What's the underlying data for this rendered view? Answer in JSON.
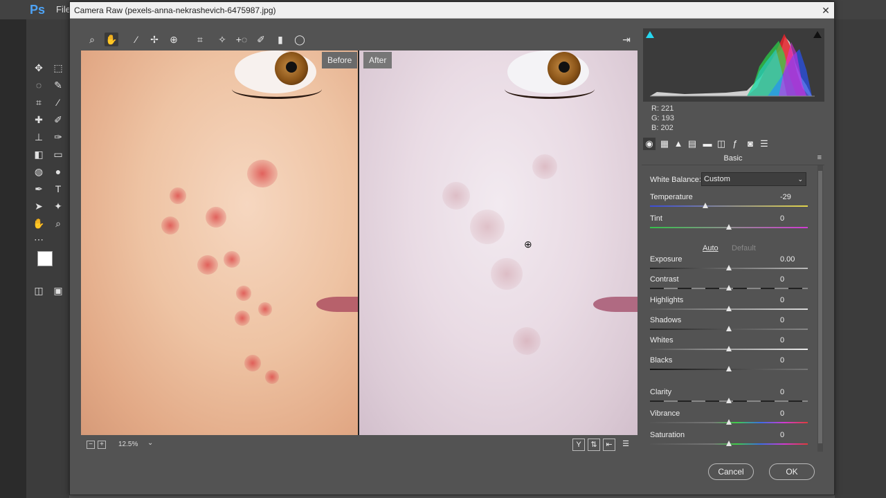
{
  "app": {
    "ps_logo": "Ps",
    "ps_menu": "File",
    "dialog_title": "Camera Raw (pexels-anna-nekrashevich-6475987.jpg)",
    "close_glyph": "✕"
  },
  "view": {
    "before_label": "Before",
    "after_label": "After",
    "zoom_level": "12.5%"
  },
  "readout": {
    "r": "R:  221",
    "g": "G:  193",
    "b": "B:  202"
  },
  "panel": {
    "title": "Basic"
  },
  "white_balance": {
    "label": "White Balance:",
    "value": "Custom"
  },
  "links": {
    "auto": "Auto",
    "default": "Default"
  },
  "sliders": [
    {
      "label": "Temperature",
      "value": "-29"
    },
    {
      "label": "Tint",
      "value": "0"
    },
    {
      "label": "Exposure",
      "value": "0.00"
    },
    {
      "label": "Contrast",
      "value": "0"
    },
    {
      "label": "Highlights",
      "value": "0"
    },
    {
      "label": "Shadows",
      "value": "0"
    },
    {
      "label": "Whites",
      "value": "0"
    },
    {
      "label": "Blacks",
      "value": "0"
    },
    {
      "label": "Clarity",
      "value": "0"
    },
    {
      "label": "Vibrance",
      "value": "0"
    },
    {
      "label": "Saturation",
      "value": "0"
    }
  ],
  "buttons": {
    "cancel": "Cancel",
    "ok": "OK"
  },
  "icons": {
    "toolbar": [
      "zoom-icon",
      "hand-icon",
      "white-balance-icon",
      "color-sampler-icon",
      "targeted-adjustment-icon",
      "crop-icon",
      "straighten-icon",
      "spot-removal-icon",
      "red-eye-icon",
      "adjustment-brush-icon",
      "graduated-filter-icon",
      "radial-filter-icon"
    ],
    "panel_tabs": [
      "basic-icon",
      "tone-curve-icon",
      "detail-icon",
      "hsl-icon",
      "split-toning-icon",
      "lens-icon",
      "effects-icon",
      "camera-calibration-icon",
      "presets-icon"
    ]
  }
}
